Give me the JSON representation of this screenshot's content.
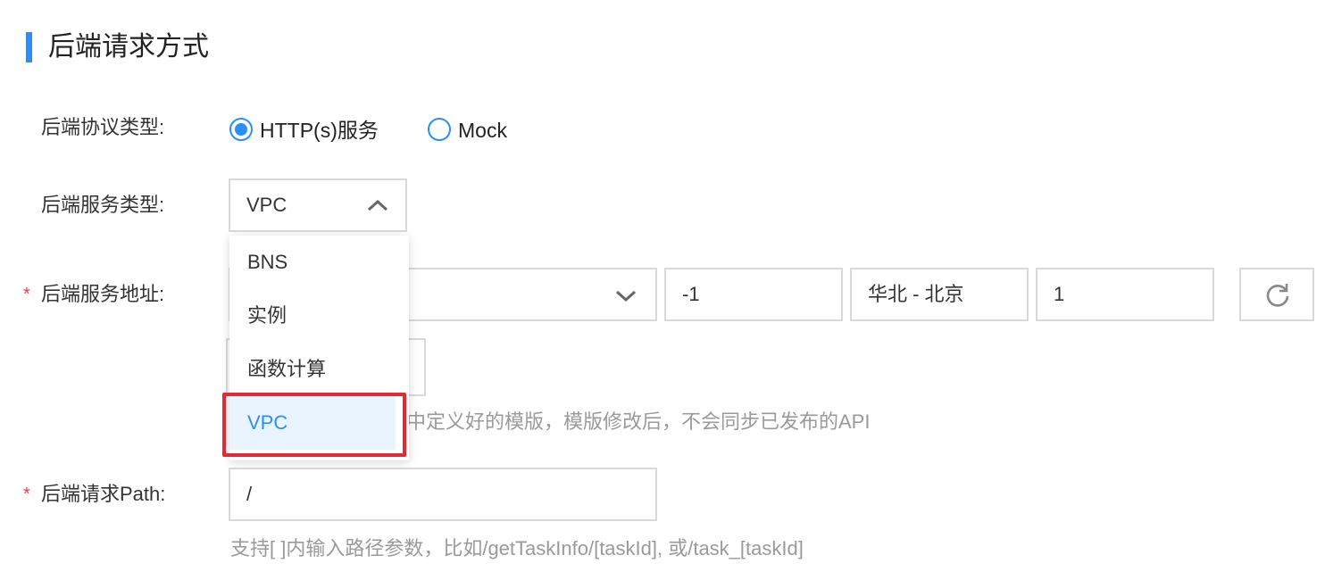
{
  "section": {
    "title": "后端请求方式"
  },
  "protocol": {
    "label": "后端协议类型:",
    "options": [
      {
        "label": "HTTP(s)服务",
        "checked": true
      },
      {
        "label": "Mock",
        "checked": false
      }
    ]
  },
  "service_type": {
    "label": "后端服务类型:",
    "selected": "VPC",
    "menu": {
      "items": [
        "BNS",
        "实例",
        "函数计算",
        "VPC"
      ],
      "active_index": 3
    }
  },
  "service_address": {
    "required_mark": "*",
    "label": "后端服务地址:",
    "fields": [
      "-1",
      "华北 - 北京",
      "1"
    ],
    "refresh_icon": "refresh-icon"
  },
  "template_hint": "中定义好的模版，模版修改后，不会同步已发布的API",
  "request_path": {
    "required_mark": "*",
    "label": "后端请求Path:",
    "value": "/",
    "hint": "支持[ ]内输入路径参数，比如/getTaskInfo/[taskId], 或/task_[taskId]"
  },
  "colors": {
    "accent": "#2a8ff7",
    "required": "#e8413c",
    "highlight": "#e02b35",
    "active_bg": "#eaf4fe"
  }
}
